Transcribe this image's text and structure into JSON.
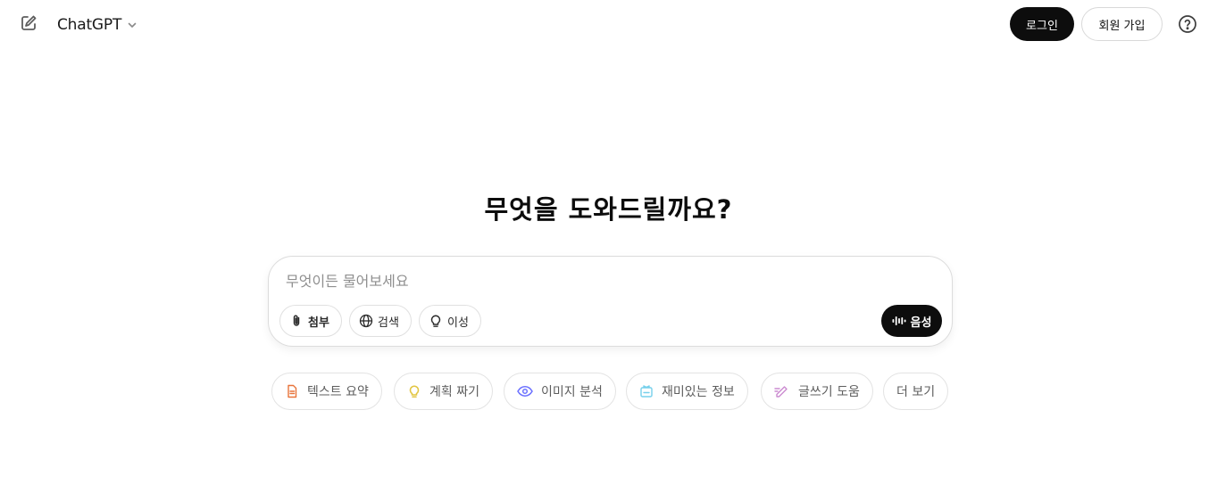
{
  "header": {
    "model_name": "ChatGPT",
    "login_label": "로그인",
    "signup_label": "회원 가입"
  },
  "main": {
    "headline": "무엇을 도와드릴까요?",
    "composer": {
      "placeholder": "무엇이든 물어보세요",
      "tools": [
        {
          "label": "첨부",
          "icon": "paperclip-icon"
        },
        {
          "label": "검색",
          "icon": "globe-icon"
        },
        {
          "label": "이성",
          "icon": "lightbulb-icon"
        }
      ],
      "voice_label": "음성"
    },
    "suggestions": [
      {
        "label": "텍스트 요약",
        "icon": "document-icon",
        "color": "#e8743b"
      },
      {
        "label": "계획 짜기",
        "icon": "lightbulb-icon",
        "color": "#e2c541"
      },
      {
        "label": "이미지 분석",
        "icon": "eye-icon",
        "color": "#6c71ff"
      },
      {
        "label": "재미있는 정보",
        "icon": "graduation-cap-icon",
        "color": "#76d0eb"
      },
      {
        "label": "글쓰기 도움",
        "icon": "pen-icon",
        "color": "#cb8bd0"
      },
      {
        "label": "더 보기",
        "icon": "",
        "color": ""
      }
    ]
  }
}
